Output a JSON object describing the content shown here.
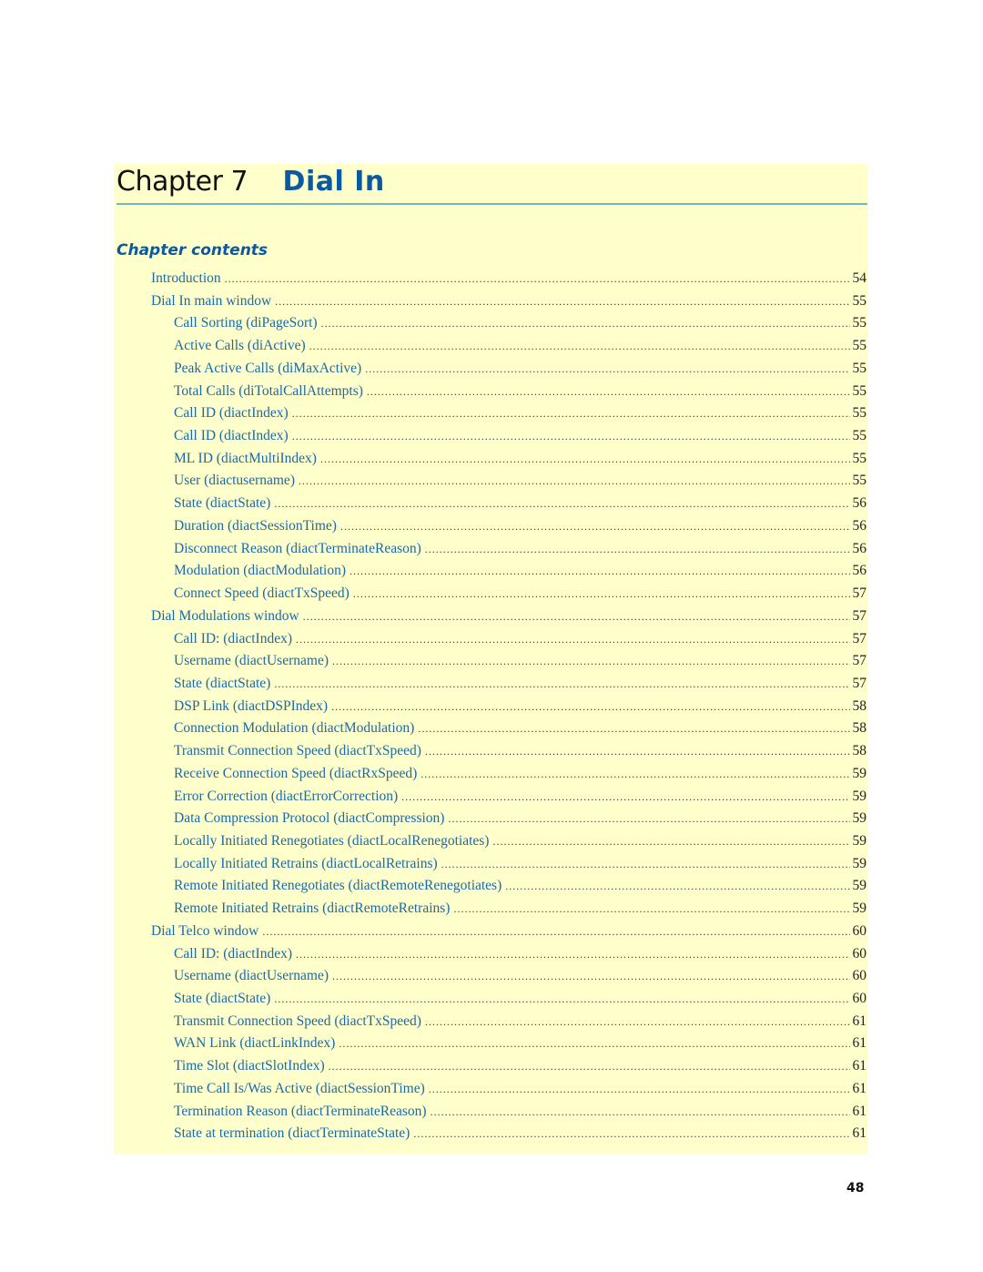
{
  "chapter": {
    "word": "Chapter",
    "number": "7",
    "title": "Dial In"
  },
  "contents_heading": "Chapter contents",
  "toc": [
    {
      "level": 1,
      "label": "Introduction",
      "page": "54"
    },
    {
      "level": 1,
      "label": "Dial In main window",
      "page": "55"
    },
    {
      "level": 2,
      "label": "Call Sorting (diPageSort)",
      "page": "55"
    },
    {
      "level": 2,
      "label": "Active Calls (diActive)",
      "page": "55"
    },
    {
      "level": 2,
      "label": "Peak Active Calls (diMaxActive)",
      "page": "55"
    },
    {
      "level": 2,
      "label": "Total Calls (diTotalCallAttempts)",
      "page": "55"
    },
    {
      "level": 2,
      "label": "Call ID (diactIndex)",
      "page": "55"
    },
    {
      "level": 2,
      "label": "Call ID (diactIndex)",
      "page": "55"
    },
    {
      "level": 2,
      "label": "ML ID (diactMultiIndex)",
      "page": "55"
    },
    {
      "level": 2,
      "label": "User (diactusername)",
      "page": "55"
    },
    {
      "level": 2,
      "label": "State (diactState)",
      "page": "56"
    },
    {
      "level": 2,
      "label": "Duration (diactSessionTime)",
      "page": "56"
    },
    {
      "level": 2,
      "label": "Disconnect Reason (diactTerminateReason)",
      "page": "56"
    },
    {
      "level": 2,
      "label": "Modulation (diactModulation)",
      "page": "56"
    },
    {
      "level": 2,
      "label": "Connect Speed (diactTxSpeed)",
      "page": "57"
    },
    {
      "level": 1,
      "label": "Dial Modulations window",
      "page": "57"
    },
    {
      "level": 2,
      "label": "Call ID: (diactIndex)",
      "page": "57"
    },
    {
      "level": 2,
      "label": "Username (diactUsername)",
      "page": "57"
    },
    {
      "level": 2,
      "label": "State (diactState)",
      "page": "57"
    },
    {
      "level": 2,
      "label": "DSP Link (diactDSPIndex)",
      "page": "58"
    },
    {
      "level": 2,
      "label": "Connection Modulation (diactModulation)",
      "page": "58"
    },
    {
      "level": 2,
      "label": "Transmit Connection Speed (diactTxSpeed)",
      "page": "58"
    },
    {
      "level": 2,
      "label": "Receive Connection Speed (diactRxSpeed)",
      "page": "59"
    },
    {
      "level": 2,
      "label": "Error Correction (diactErrorCorrection)",
      "page": "59"
    },
    {
      "level": 2,
      "label": "Data Compression Protocol (diactCompression)",
      "page": "59"
    },
    {
      "level": 2,
      "label": "Locally Initiated Renegotiates (diactLocalRenegotiates)",
      "page": "59"
    },
    {
      "level": 2,
      "label": "Locally Initiated Retrains (diactLocalRetrains)",
      "page": "59"
    },
    {
      "level": 2,
      "label": "Remote Initiated Renegotiates (diactRemoteRenegotiates)",
      "page": "59"
    },
    {
      "level": 2,
      "label": "Remote Initiated Retrains (diactRemoteRetrains)",
      "page": "59"
    },
    {
      "level": 1,
      "label": "Dial Telco window",
      "page": "60"
    },
    {
      "level": 2,
      "label": "Call ID: (diactIndex)",
      "page": "60"
    },
    {
      "level": 2,
      "label": "Username (diactUsername)",
      "page": "60"
    },
    {
      "level": 2,
      "label": "State (diactState)",
      "page": "60"
    },
    {
      "level": 2,
      "label": "Transmit Connection Speed (diactTxSpeed)",
      "page": "61"
    },
    {
      "level": 2,
      "label": "WAN Link (diactLinkIndex)",
      "page": "61"
    },
    {
      "level": 2,
      "label": "Time Slot (diactSlotIndex)",
      "page": "61"
    },
    {
      "level": 2,
      "label": "Time Call Is/Was Active (diactSessionTime)",
      "page": "61"
    },
    {
      "level": 2,
      "label": "Termination Reason (diactTerminateReason)",
      "page": "61"
    },
    {
      "level": 2,
      "label": "State at termination (diactTerminateState)",
      "page": "61"
    }
  ],
  "page_number": "48",
  "colors": {
    "panel_background": "#ffffcc",
    "title_blue": "#0a5aa0",
    "link_blue": "#1a6aa8",
    "rule_teal": "#74b8bc"
  }
}
